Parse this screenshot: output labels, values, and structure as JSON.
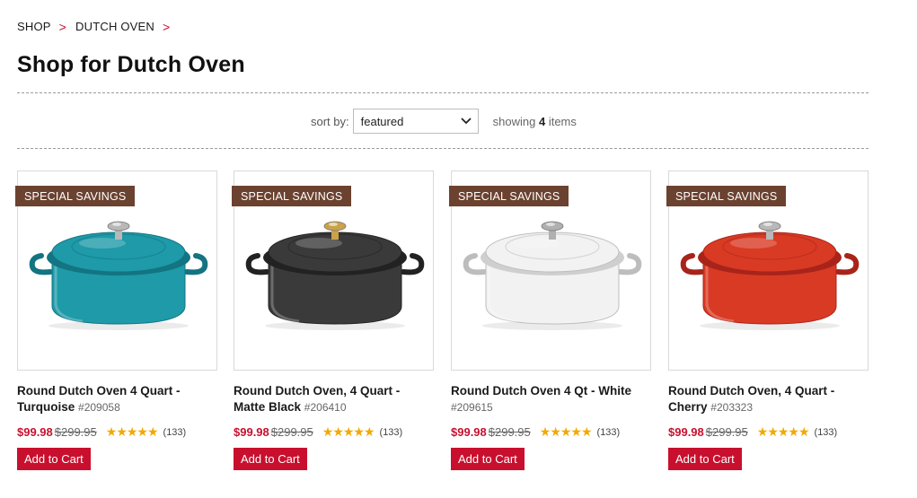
{
  "breadcrumb": {
    "items": [
      "SHOP",
      "DUTCH OVEN"
    ],
    "separator": ">"
  },
  "page_title": "Shop for Dutch Oven",
  "sort": {
    "label": "sort by:",
    "selected": "featured"
  },
  "showing": {
    "prefix": "showing",
    "count": "4",
    "suffix": "items"
  },
  "products": [
    {
      "badge": "SPECIAL SAVINGS",
      "name": "Round Dutch Oven 4 Quart - Turquoise",
      "sku": "#209058",
      "sale_price": "$99.98",
      "original_price": "$299.95",
      "stars": "★★★★★",
      "rating": 5,
      "reviews": "(133)",
      "cart_label": "Add to Cart",
      "color": "#1e9aa8",
      "color_dark": "#137482",
      "knob": "#b8b8b8"
    },
    {
      "badge": "SPECIAL SAVINGS",
      "name": "Round Dutch Oven, 4 Quart - Matte Black",
      "sku": "#206410",
      "sale_price": "$99.98",
      "original_price": "$299.95",
      "stars": "★★★★★",
      "rating": 5,
      "reviews": "(133)",
      "cart_label": "Add to Cart",
      "color": "#3a3a3a",
      "color_dark": "#222222",
      "knob": "#c9a24a"
    },
    {
      "badge": "SPECIAL SAVINGS",
      "name": "Round Dutch Oven 4 Qt - White",
      "sku": "#209615",
      "sale_price": "$99.98",
      "original_price": "$299.95",
      "stars": "★★★★★",
      "rating": 5,
      "reviews": "(133)",
      "cart_label": "Add to Cart",
      "color": "#f2f2f2",
      "color_dark": "#cfcfcf",
      "knob": "#b0b0b0"
    },
    {
      "badge": "SPECIAL SAVINGS",
      "name": "Round Dutch Oven, 4 Quart - Cherry",
      "sku": "#203323",
      "sale_price": "$99.98",
      "original_price": "$299.95",
      "stars": "★★★★★",
      "rating": 5,
      "reviews": "(133)",
      "cart_label": "Add to Cart",
      "color": "#d93a24",
      "color_dark": "#a8241a",
      "knob": "#b8b8b8"
    }
  ],
  "icons": {
    "breadcrumb_separator": "chevron-right-icon",
    "sort_dropdown": "chevron-down-icon",
    "rating": "star-icon"
  },
  "colors": {
    "accent": "#c8102e",
    "badge": "#6b4230",
    "stars": "#f2a900"
  }
}
